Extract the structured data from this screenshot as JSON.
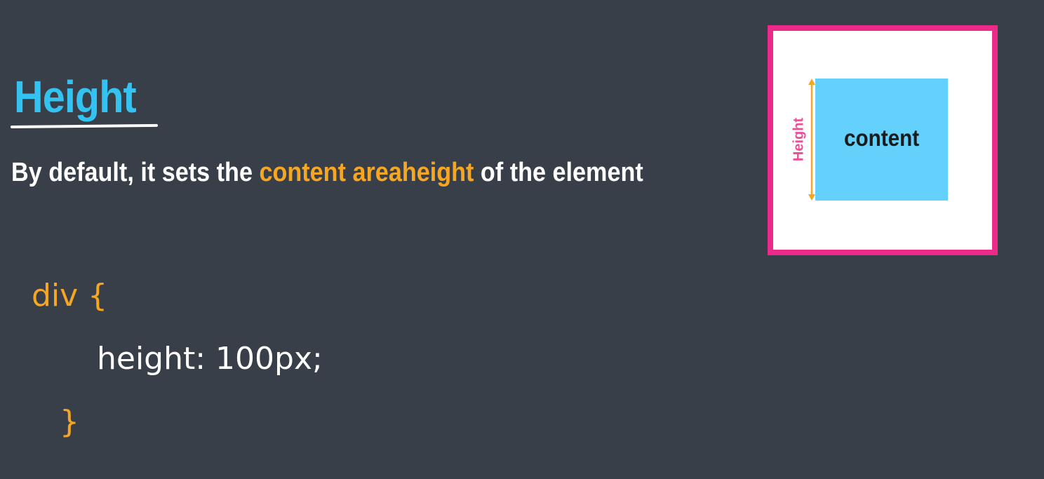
{
  "slide": {
    "title": "Height",
    "subtitle": {
      "before": "By default, it sets the ",
      "highlight_1": "content area",
      "highlight_2": "height",
      "after": " of the element"
    },
    "code": {
      "open": "div {",
      "property": "height:  100px;",
      "close": "}"
    },
    "diagram": {
      "content_label": "content",
      "height_label": "Height"
    }
  },
  "colors": {
    "background": "#383f48",
    "title": "#34c3f0",
    "highlight": "#f5a623",
    "border": "#ec2a89",
    "content_fill": "#64d0fc",
    "height_label": "#ec4d96"
  }
}
